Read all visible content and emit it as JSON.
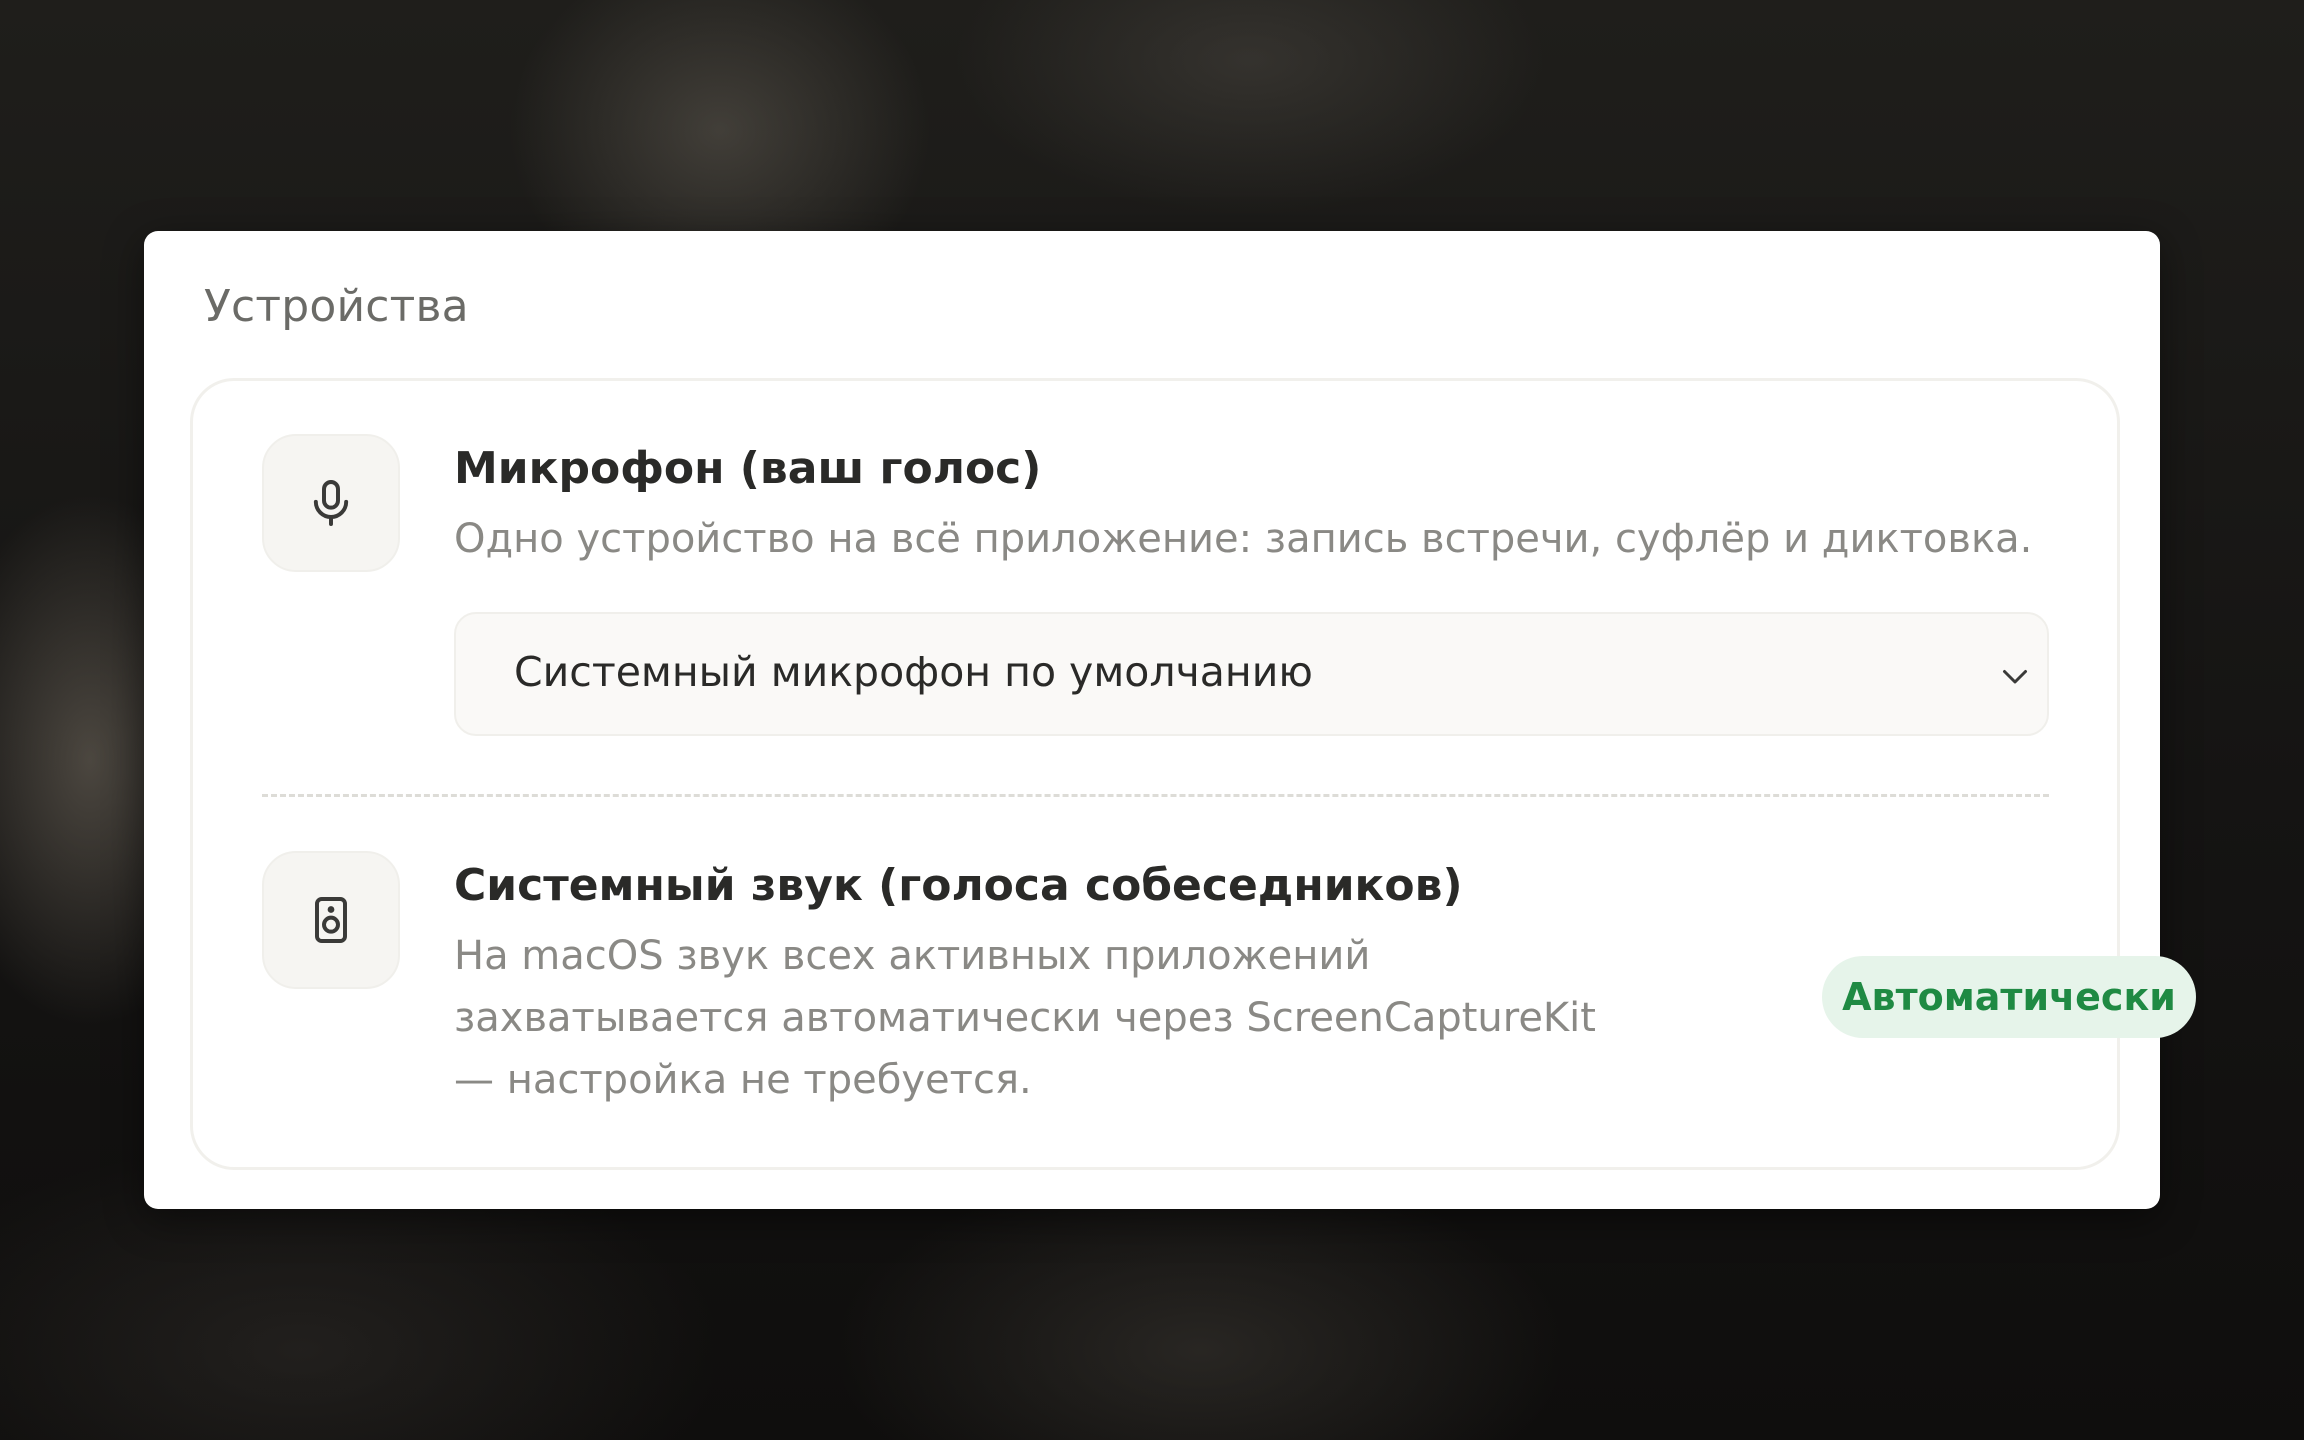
{
  "panel": {
    "title": "Устройства"
  },
  "microphone": {
    "icon": "microphone-icon",
    "title": "Микрофон (ваш голос)",
    "description": "Одно устройство на всё приложение: запись встречи, суфлёр и диктовка.",
    "select": {
      "value": "Системный микрофон по умолчанию",
      "chevron": "chevron-down-icon"
    }
  },
  "system_audio": {
    "icon": "speaker-icon",
    "title": "Системный звук (голоса собеседников)",
    "description_lines": [
      "На macOS звук всех активных приложений",
      "захватывается автоматически через ScreenCaptureKit",
      "— настройка не требуется."
    ],
    "badge": "Автоматически",
    "badge_color": "#1f8a43",
    "badge_bg": "#e6f4ea"
  }
}
